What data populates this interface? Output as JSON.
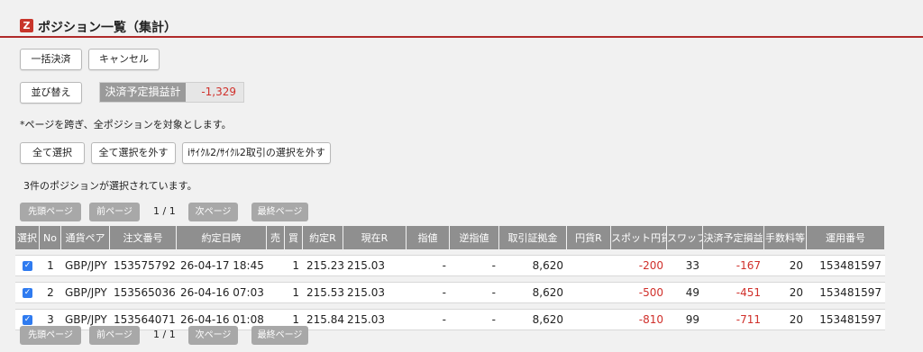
{
  "header": {
    "logo": "Z",
    "title": "ポジション一覧（集計）"
  },
  "actions": {
    "bulk_settle": "一括決済",
    "cancel": "キャンセル",
    "sort": "並び替え",
    "pl_label": "決済予定損益計",
    "pl_value": "-1,329"
  },
  "note": "*ページを跨ぎ、全ポジションを対象とします。",
  "selection": {
    "select_all": "全て選択",
    "deselect_all": "全て選択を外す",
    "deselect_cycle": "iｻｲｸﾙ2/ｻｲｸﾙ2取引の選択を外す",
    "selected_text": "3件のポジションが選択されています。"
  },
  "pagination": {
    "first": "先頭ページ",
    "prev": "前ページ",
    "info": "1 / 1",
    "next": "次ページ",
    "last": "最終ページ"
  },
  "table": {
    "headers": [
      "選択",
      "No",
      "通貨ペア",
      "注文番号",
      "約定日時",
      "売",
      "買",
      "約定R",
      "現在R",
      "指値",
      "逆指値",
      "取引証拠金",
      "円貨R",
      "スポット円貨",
      "スワップ",
      "決済予定損益",
      "手数料等",
      "運用番号"
    ],
    "rows": [
      {
        "checked": "✓",
        "no": "1",
        "pair": "GBP/JPY",
        "order": "153575792",
        "datetime": "26-04-17 18:45",
        "sell": "",
        "buy": "1",
        "exec_rate": "215.23",
        "cur_rate": "215.03",
        "limit": "-",
        "stop": "-",
        "margin": "8,620",
        "yen_rate": "",
        "spot_yen": "-200",
        "swap": "33",
        "pl": "-167",
        "fee": "20",
        "op_no": "153481597"
      },
      {
        "checked": "✓",
        "no": "2",
        "pair": "GBP/JPY",
        "order": "153565036",
        "datetime": "26-04-16 07:03",
        "sell": "",
        "buy": "1",
        "exec_rate": "215.53",
        "cur_rate": "215.03",
        "limit": "-",
        "stop": "-",
        "margin": "8,620",
        "yen_rate": "",
        "spot_yen": "-500",
        "swap": "49",
        "pl": "-451",
        "fee": "20",
        "op_no": "153481597"
      },
      {
        "checked": "✓",
        "no": "3",
        "pair": "GBP/JPY",
        "order": "153564071",
        "datetime": "26-04-16 01:08",
        "sell": "",
        "buy": "1",
        "exec_rate": "215.84",
        "cur_rate": "215.03",
        "limit": "-",
        "stop": "-",
        "margin": "8,620",
        "yen_rate": "",
        "spot_yen": "-810",
        "swap": "99",
        "pl": "-711",
        "fee": "20",
        "op_no": "153481597"
      }
    ]
  },
  "colors": {
    "accent": "#b02a2a",
    "negative": "#d0302b",
    "header_bg": "#8f8f8f",
    "checkbox": "#2f7bf0"
  }
}
